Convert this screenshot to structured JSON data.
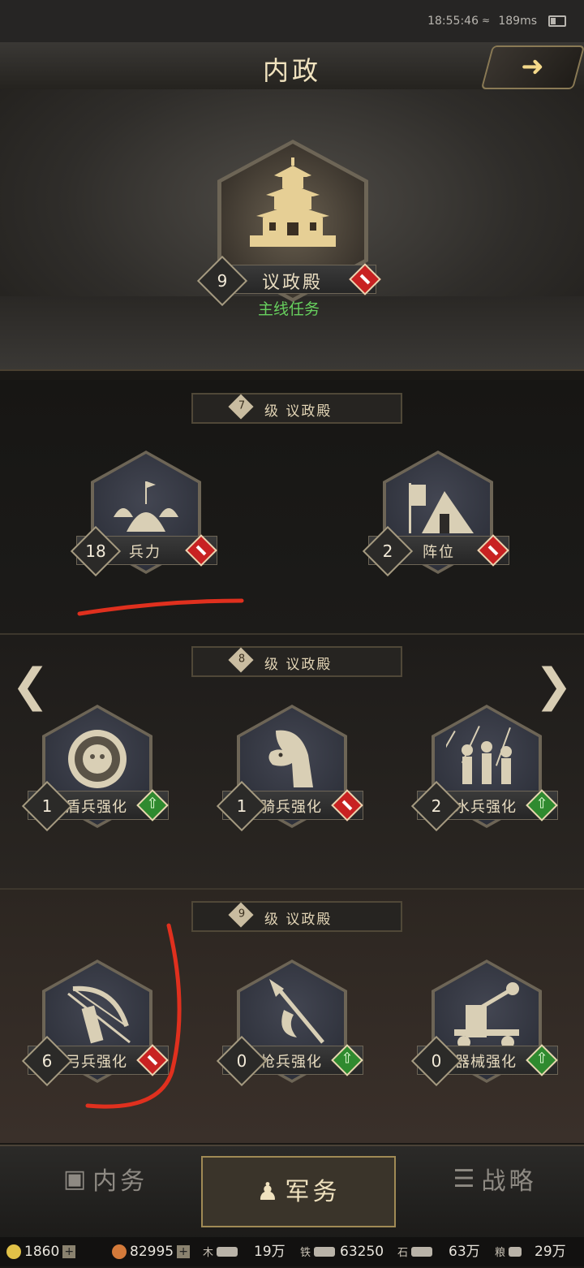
{
  "status": {
    "time": "18:55:46",
    "ping": "189ms"
  },
  "header": {
    "title": "内政",
    "back_icon": "arrow-right-icon"
  },
  "main_building": {
    "level": "9",
    "name": "议政殿",
    "quest": "主线任务"
  },
  "sections": [
    {
      "req_level": "7",
      "req_text": "级  议政殿",
      "buildings": [
        {
          "level": "18",
          "name": "兵力",
          "action": "minus"
        },
        {
          "level": "2",
          "name": "阵位",
          "action": "minus"
        }
      ]
    },
    {
      "req_level": "8",
      "req_text": "级  议政殿",
      "buildings": [
        {
          "level": "1",
          "name": "盾兵强化",
          "action": "up"
        },
        {
          "level": "1",
          "name": "骑兵强化",
          "action": "minus"
        },
        {
          "level": "2",
          "name": "水兵强化",
          "action": "up"
        }
      ]
    },
    {
      "req_level": "9",
      "req_text": "级  议政殿",
      "buildings": [
        {
          "level": "6",
          "name": "弓兵强化",
          "action": "minus"
        },
        {
          "level": "0",
          "name": "枪兵强化",
          "action": "up"
        },
        {
          "level": "0",
          "name": "器械强化",
          "action": "up"
        }
      ]
    }
  ],
  "tabs": [
    {
      "label": "内务"
    },
    {
      "label": "军务"
    },
    {
      "label": "战略"
    }
  ],
  "resources": {
    "gold": "1860",
    "copper": "82995",
    "wood_label": "木",
    "wood": "19万",
    "iron_label": "铁",
    "iron": "63250",
    "stone_label": "石",
    "stone": "63万",
    "grain_label": "粮",
    "grain": "29万"
  },
  "colors": {
    "quest": "#67d15e",
    "minus": "#c82222",
    "up": "#2f8a2f",
    "accent": "#a08a55"
  }
}
